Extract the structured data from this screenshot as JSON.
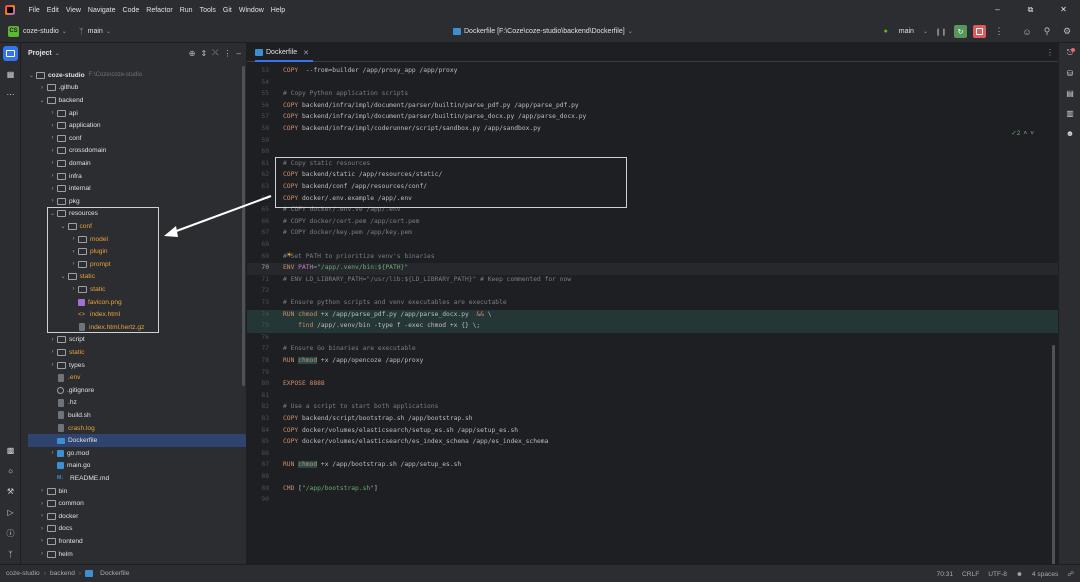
{
  "menu": [
    "File",
    "Edit",
    "View",
    "Navigate",
    "Code",
    "Refactor",
    "Run",
    "Tools",
    "Git",
    "Window",
    "Help"
  ],
  "toolbar": {
    "project_badge": "CS",
    "project_name": "coze-studio",
    "branch": "main",
    "file_title": "Dockerfile [F:\\Coze\\coze-studio\\backend\\Dockerfile]",
    "run_config": "main"
  },
  "project_panel": {
    "title": "Project",
    "tree": [
      {
        "d": 0,
        "type": "folder",
        "open": true,
        "name": "coze-studio",
        "note": "F:\\Coze\\coze-studio",
        "bold": true
      },
      {
        "d": 1,
        "type": "folder",
        "open": false,
        "name": ".github"
      },
      {
        "d": 1,
        "type": "folder",
        "open": true,
        "name": "backend"
      },
      {
        "d": 2,
        "type": "folder",
        "open": false,
        "name": "api"
      },
      {
        "d": 2,
        "type": "folder",
        "open": false,
        "name": "application"
      },
      {
        "d": 2,
        "type": "folder",
        "open": false,
        "name": "conf"
      },
      {
        "d": 2,
        "type": "folder",
        "open": false,
        "name": "crossdomain"
      },
      {
        "d": 2,
        "type": "folder",
        "open": false,
        "name": "domain"
      },
      {
        "d": 2,
        "type": "folder",
        "open": false,
        "name": "infra"
      },
      {
        "d": 2,
        "type": "folder",
        "open": false,
        "name": "internal"
      },
      {
        "d": 2,
        "type": "folder",
        "open": false,
        "name": "pkg"
      },
      {
        "d": 2,
        "type": "folder",
        "open": true,
        "name": "resources"
      },
      {
        "d": 3,
        "type": "folder",
        "open": true,
        "name": "conf",
        "color": "orange"
      },
      {
        "d": 4,
        "type": "folder",
        "open": false,
        "name": "model",
        "color": "orange"
      },
      {
        "d": 4,
        "type": "folder",
        "open": false,
        "name": "plugin",
        "color": "orange"
      },
      {
        "d": 4,
        "type": "folder",
        "open": false,
        "name": "prompt",
        "color": "orange"
      },
      {
        "d": 3,
        "type": "folder",
        "open": true,
        "name": "static",
        "color": "orange"
      },
      {
        "d": 4,
        "type": "folder",
        "open": false,
        "name": "static",
        "color": "orange"
      },
      {
        "d": 4,
        "type": "img",
        "name": "favicon.png",
        "color": "orange"
      },
      {
        "d": 4,
        "type": "html",
        "name": "index.html",
        "color": "orange"
      },
      {
        "d": 4,
        "type": "gen",
        "name": "index.html.hertz.gz",
        "color": "orange"
      },
      {
        "d": 2,
        "type": "folder",
        "open": false,
        "name": "script"
      },
      {
        "d": 2,
        "type": "folder",
        "open": false,
        "name": "static",
        "color": "orange"
      },
      {
        "d": 2,
        "type": "folder",
        "open": false,
        "name": "types"
      },
      {
        "d": 2,
        "type": "gen",
        "name": ".env",
        "color": "orange"
      },
      {
        "d": 2,
        "type": "git",
        "name": ".gitignore"
      },
      {
        "d": 2,
        "type": "gen",
        "name": ".hz"
      },
      {
        "d": 2,
        "type": "gen",
        "name": "build.sh"
      },
      {
        "d": 2,
        "type": "gen",
        "name": "crash.log",
        "color": "orange"
      },
      {
        "d": 2,
        "type": "docker",
        "name": "Dockerfile",
        "selected": true
      },
      {
        "d": 2,
        "type": "go",
        "name": "go.mod",
        "collapsible": true
      },
      {
        "d": 2,
        "type": "go",
        "name": "main.go"
      },
      {
        "d": 2,
        "type": "md",
        "name": "README.md"
      },
      {
        "d": 1,
        "type": "folder",
        "open": false,
        "name": "bin"
      },
      {
        "d": 1,
        "type": "folder",
        "open": false,
        "name": "common"
      },
      {
        "d": 1,
        "type": "folder",
        "open": false,
        "name": "docker"
      },
      {
        "d": 1,
        "type": "folder",
        "open": false,
        "name": "docs"
      },
      {
        "d": 1,
        "type": "folder",
        "open": false,
        "name": "frontend"
      },
      {
        "d": 1,
        "type": "folder",
        "open": false,
        "name": "helm"
      }
    ]
  },
  "editor": {
    "tab": "Dockerfile",
    "inspection": "2",
    "current_line": 70,
    "lines": [
      {
        "n": 53,
        "segs": [
          [
            "kw",
            "COPY"
          ],
          [
            "",
            "  --from=builder /app/proxy_app /app/proxy"
          ]
        ]
      },
      {
        "n": 54,
        "segs": []
      },
      {
        "n": 55,
        "segs": [
          [
            "cm",
            "# Copy Python application scripts"
          ]
        ]
      },
      {
        "n": 56,
        "segs": [
          [
            "kw",
            "COPY"
          ],
          [
            "",
            " backend/infra/impl/document/parser/builtin/parse_pdf.py /app/parse_pdf.py"
          ]
        ]
      },
      {
        "n": 57,
        "segs": [
          [
            "kw",
            "COPY"
          ],
          [
            "",
            " backend/infra/impl/document/parser/builtin/parse_docx.py /app/parse_docx.py"
          ]
        ]
      },
      {
        "n": 58,
        "segs": [
          [
            "kw",
            "COPY"
          ],
          [
            "",
            " backend/infra/impl/coderunner/script/sandbox.py /app/sandbox.py"
          ]
        ]
      },
      {
        "n": 59,
        "segs": []
      },
      {
        "n": 60,
        "segs": []
      },
      {
        "n": 61,
        "segs": [
          [
            "cm",
            "# Copy static resources"
          ]
        ]
      },
      {
        "n": 62,
        "segs": [
          [
            "kw",
            "COPY"
          ],
          [
            "",
            " backend/static /app/resources/static/"
          ]
        ]
      },
      {
        "n": 63,
        "segs": [
          [
            "kw",
            "COPY"
          ],
          [
            "",
            " backend/conf /app/resources/conf/"
          ]
        ]
      },
      {
        "n": 64,
        "segs": [
          [
            "kw",
            "COPY"
          ],
          [
            "",
            " docker/.env.example /app/.env"
          ]
        ]
      },
      {
        "n": 65,
        "segs": [
          [
            "cm",
            "# COPY docker/.env.ve /app/.env"
          ]
        ]
      },
      {
        "n": 66,
        "segs": [
          [
            "cm",
            "# COPY docker/cert.pem /app/cert.pem"
          ]
        ]
      },
      {
        "n": 67,
        "segs": [
          [
            "cm",
            "# COPY docker/key.pem /app/key.pem"
          ]
        ]
      },
      {
        "n": 68,
        "segs": []
      },
      {
        "n": 69,
        "segs": [
          [
            "cm",
            "# Set PATH to prioritize venv's binaries"
          ]
        ]
      },
      {
        "n": 70,
        "segs": [
          [
            "kw",
            "ENV"
          ],
          [
            "",
            " "
          ],
          [
            "var",
            "PATH"
          ],
          [
            "str",
            "=\"/app/.venv/bin:${PATH}\""
          ]
        ]
      },
      {
        "n": 71,
        "segs": [
          [
            "cm",
            "# ENV LD_LIBRARY_PATH=\"/usr/lib:${LD_LIBRARY_PATH}\" # Keep commented for now"
          ]
        ]
      },
      {
        "n": 72,
        "segs": []
      },
      {
        "n": 73,
        "segs": [
          [
            "cm",
            "# Ensure python scripts and venv executables are executable"
          ]
        ]
      },
      {
        "n": 74,
        "segs": [
          [
            "kw",
            "RUN"
          ],
          [
            "",
            " "
          ],
          [
            "kw",
            "chmod"
          ],
          [
            "",
            " +x /app/parse_pdf.py /app/parse_docx.py  "
          ],
          [
            "kw",
            "&&"
          ],
          [
            "",
            " \\"
          ]
        ]
      },
      {
        "n": 75,
        "segs": [
          [
            "",
            "    "
          ],
          [
            "kw",
            "find"
          ],
          [
            "",
            " /app/.venv/bin -type f -exec chmod +x {} \\;"
          ]
        ]
      },
      {
        "n": 76,
        "segs": []
      },
      {
        "n": 77,
        "segs": [
          [
            "cm",
            "# Ensure Go binaries are executable"
          ]
        ]
      },
      {
        "n": 78,
        "segs": [
          [
            "kw",
            "RUN"
          ],
          [
            "",
            " "
          ],
          [
            "kw",
            "chmod"
          ],
          [
            "",
            " +x /app/opencoze /app/proxy"
          ]
        ]
      },
      {
        "n": 79,
        "segs": []
      },
      {
        "n": 80,
        "segs": [
          [
            "kw",
            "EXPOSE"
          ],
          [
            "",
            " "
          ],
          [
            "kw",
            "8888"
          ]
        ]
      },
      {
        "n": 81,
        "segs": []
      },
      {
        "n": 82,
        "segs": [
          [
            "cm",
            "# Use a script to start both applications"
          ]
        ]
      },
      {
        "n": 83,
        "segs": [
          [
            "kw",
            "COPY"
          ],
          [
            "",
            " backend/script/bootstrap.sh /app/bootstrap.sh"
          ]
        ]
      },
      {
        "n": 84,
        "segs": [
          [
            "kw",
            "COPY"
          ],
          [
            "",
            " docker/volumes/elasticsearch/setup_es.sh /app/setup_es.sh"
          ]
        ]
      },
      {
        "n": 85,
        "segs": [
          [
            "kw",
            "COPY"
          ],
          [
            "",
            " docker/volumes/elasticsearch/es_index_schema /app/es_index_schema"
          ]
        ]
      },
      {
        "n": 86,
        "segs": []
      },
      {
        "n": 87,
        "segs": [
          [
            "kw",
            "RUN"
          ],
          [
            "",
            " "
          ],
          [
            "kw",
            "chmod"
          ],
          [
            "",
            " +x /app/bootstrap.sh /app/setup_es.sh"
          ]
        ]
      },
      {
        "n": 88,
        "segs": []
      },
      {
        "n": 89,
        "segs": [
          [
            "kw",
            "CMD"
          ],
          [
            "",
            " ["
          ],
          [
            "str",
            "\"/app/bootstrap.sh\""
          ],
          [
            "",
            "]"
          ]
        ]
      },
      {
        "n": 90,
        "segs": []
      }
    ]
  },
  "statusbar": {
    "crumbs": [
      "coze-studio",
      "backend",
      "Dockerfile"
    ],
    "position": "70:31",
    "line_sep": "CRLF",
    "encoding": "UTF-8",
    "indent": "4 spaces"
  }
}
